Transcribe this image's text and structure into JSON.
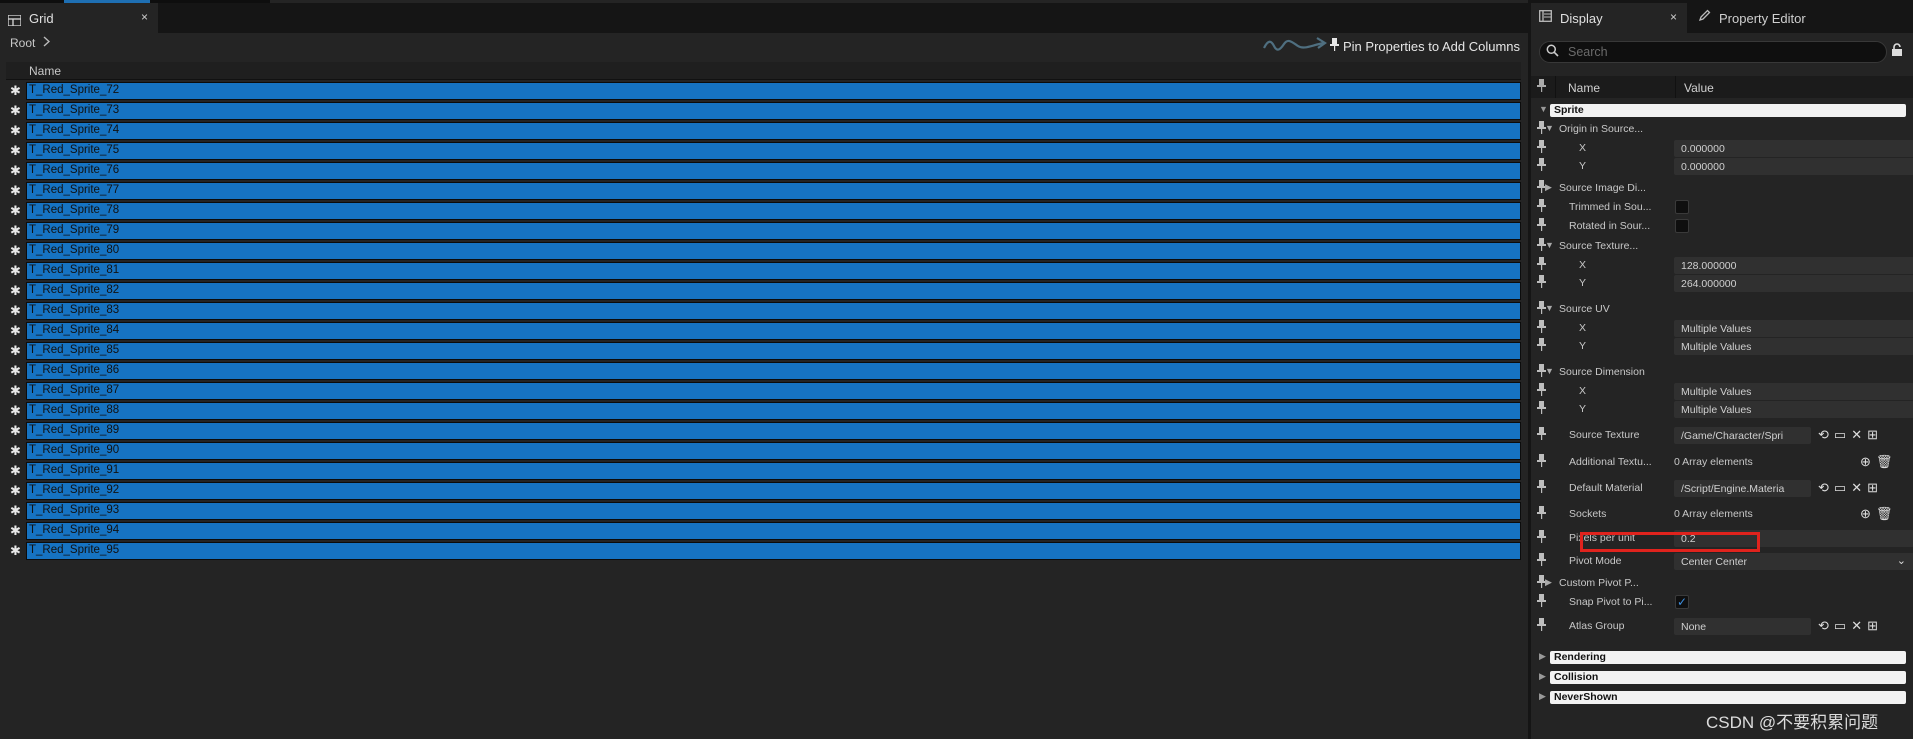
{
  "grid": {
    "tab_title": "Grid",
    "tab_icon": "grid-icon",
    "close_label": "×",
    "breadcrumb_root": "Root",
    "pin_hint": "Pin Properties to Add Columns",
    "column_name": "Name",
    "rows": [
      "T_Red_Sprite_72",
      "T_Red_Sprite_73",
      "T_Red_Sprite_74",
      "T_Red_Sprite_75",
      "T_Red_Sprite_76",
      "T_Red_Sprite_77",
      "T_Red_Sprite_78",
      "T_Red_Sprite_79",
      "T_Red_Sprite_80",
      "T_Red_Sprite_81",
      "T_Red_Sprite_82",
      "T_Red_Sprite_83",
      "T_Red_Sprite_84",
      "T_Red_Sprite_85",
      "T_Red_Sprite_86",
      "T_Red_Sprite_87",
      "T_Red_Sprite_88",
      "T_Red_Sprite_89",
      "T_Red_Sprite_90",
      "T_Red_Sprite_91",
      "T_Red_Sprite_92",
      "T_Red_Sprite_93",
      "T_Red_Sprite_94",
      "T_Red_Sprite_95"
    ],
    "row_color": "#1673c2"
  },
  "details": {
    "tab_display": "Display",
    "tab_property_editor": "Property Editor",
    "close_label": "×",
    "search_placeholder": "Search",
    "col_name": "Name",
    "col_value": "Value",
    "sprite_category": "Sprite",
    "origin_in_source": "Origin in Source...",
    "x": "X",
    "y": "Y",
    "origin_x": "0.000000",
    "origin_y": "0.000000",
    "source_image_di": "Source Image Di...",
    "trimmed_in_sou": "Trimmed in Sou...",
    "rotated_in_sour": "Rotated in Sour...",
    "source_texture_group": "Source Texture...",
    "source_texture_x": "128.000000",
    "source_texture_y": "264.000000",
    "source_uv": "Source UV",
    "multiple_values": "Multiple Values",
    "source_dimension": "Source Dimension",
    "source_texture": "Source Texture",
    "source_texture_value": "/Game/Character/Spri",
    "additional_textu": "Additional Textu...",
    "array_elements": "0 Array elements",
    "default_material": "Default Material",
    "default_material_value": "/Script/Engine.Materia",
    "sockets": "Sockets",
    "pixels_per_unit": "Pixels per unit",
    "pixels_per_unit_value": "0.2",
    "pivot_mode": "Pivot Mode",
    "pivot_mode_value": "Center Center",
    "custom_pivot": "Custom Pivot P...",
    "snap_pivot": "Snap Pivot to Pi...",
    "atlas_group": "Atlas Group",
    "atlas_group_value": "None",
    "cat_rendering": "Rendering",
    "cat_collision": "Collision",
    "cat_nevershown": "NeverShown",
    "highlight_color": "#e0231d"
  },
  "watermark": "CSDN @不要积累问题"
}
